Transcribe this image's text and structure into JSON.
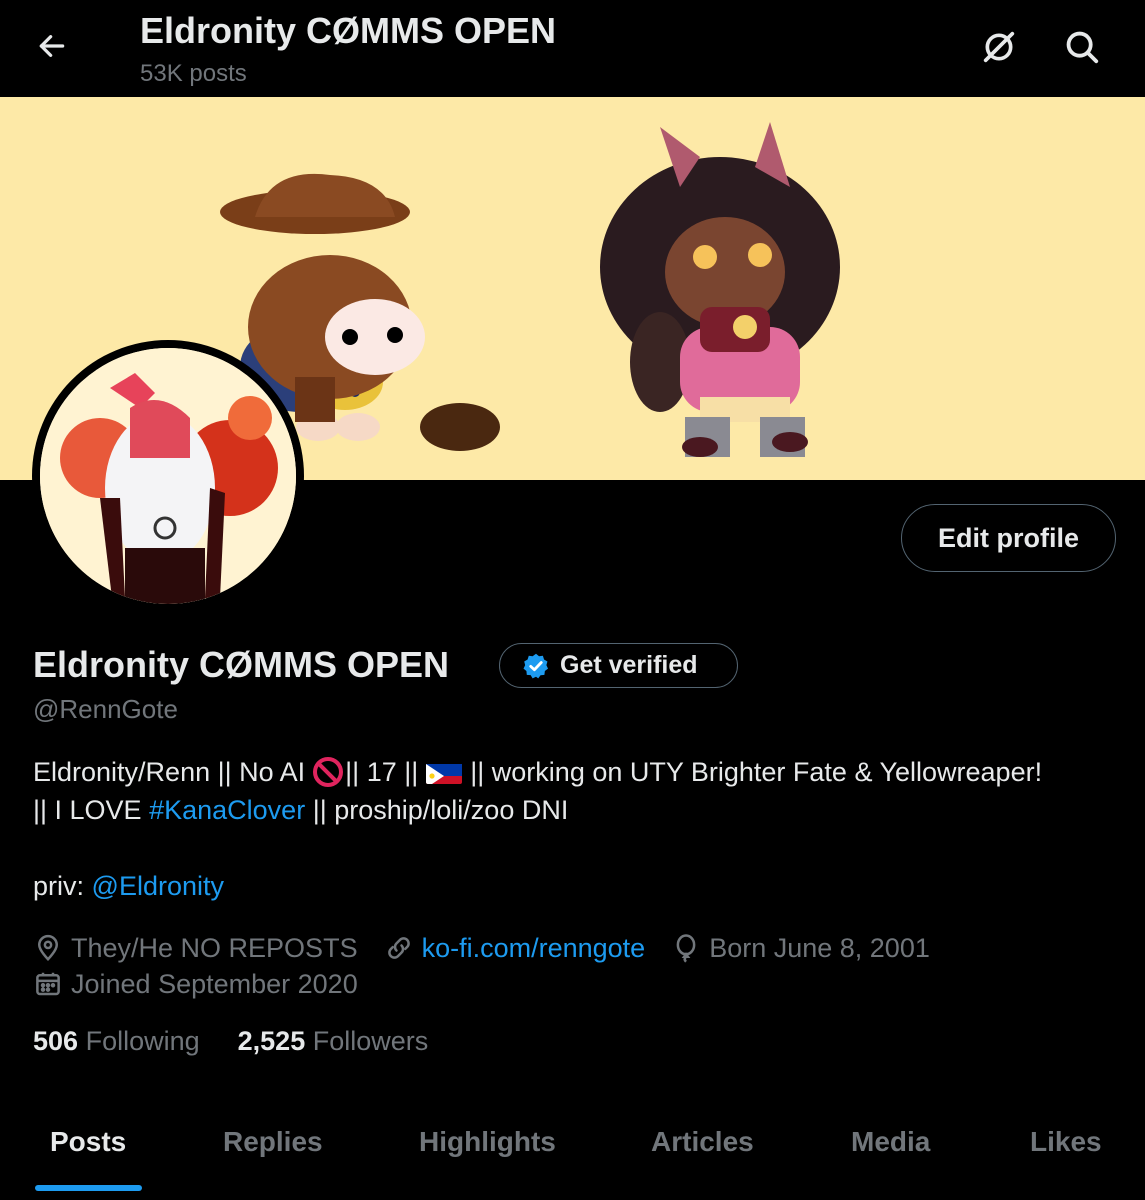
{
  "header": {
    "title": "Eldronity CØMMS OPEN",
    "post_count": "53K posts"
  },
  "profile": {
    "display_name": "Eldronity CØMMS OPEN",
    "verify_label": "Get verified",
    "handle": "@RennGote",
    "edit_label": "Edit profile"
  },
  "bio": {
    "line1_a": "Eldronity/Renn || No AI",
    "line1_b": "|| 17 ||",
    "line1_c": "|| working on UTY Brighter Fate & Yellowreaper!",
    "line2_a": "|| I LOVE",
    "line2_link": "#KanaClover",
    "line2_b": "|| proship/loli/zoo DNI",
    "priv_label": "priv:",
    "priv_link": "@Eldronity"
  },
  "meta": {
    "location": "They/He NO REPOSTS",
    "website": "ko-fi.com/renngote",
    "birthday": "Born June 8, 2001",
    "joined": "Joined September 2020"
  },
  "stats": {
    "following_count": "506",
    "following_label": "Following",
    "followers_count": "2,525",
    "followers_label": "Followers"
  },
  "tabs": [
    "Posts",
    "Replies",
    "Highlights",
    "Articles",
    "Media",
    "Likes"
  ],
  "colors": {
    "accent": "#1d9bf0",
    "banner": "#fde9a7",
    "muted": "#71767b"
  }
}
